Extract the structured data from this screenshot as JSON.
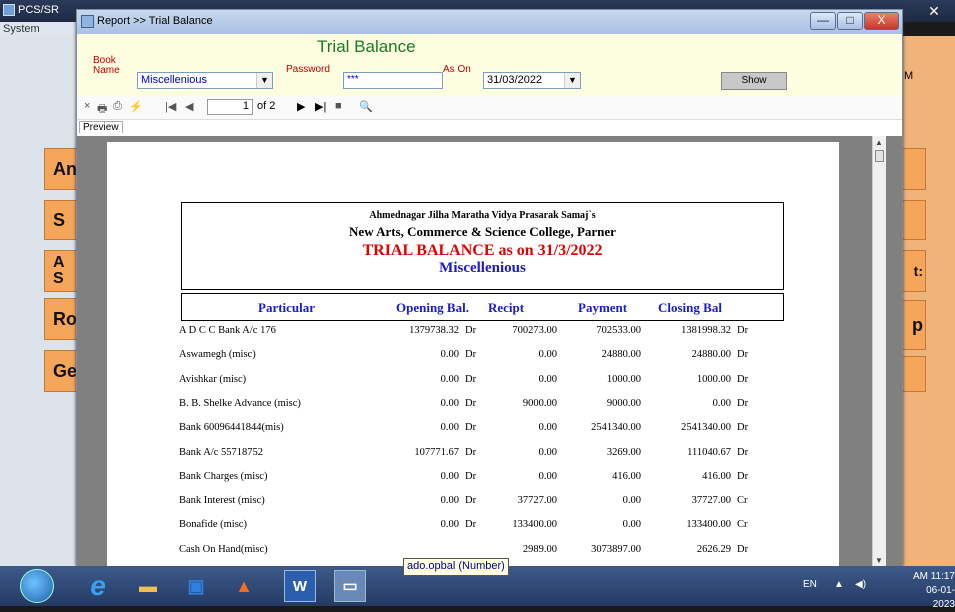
{
  "outer_window": {
    "title": "PCS/SR",
    "menu": "System",
    "close": "✕"
  },
  "side_buttons": [
    {
      "label": "An"
    },
    {
      "label": "S"
    },
    {
      "label": "A\nS"
    },
    {
      "label": "Ro"
    },
    {
      "label": "Ge"
    }
  ],
  "right_buttons": [
    {
      "label": "p"
    }
  ],
  "right_strip_letters": {
    "m": "M",
    "t": "t:"
  },
  "window": {
    "title": "Report >> Trial Balance",
    "controls": {
      "minimize": "—",
      "maximize": "□",
      "close": "X"
    }
  },
  "form": {
    "heading": "Trial Balance",
    "book_label": "Book\nName",
    "book_value": "Miscellenious",
    "password_label": "Password",
    "password_value": "***",
    "as_on_label": "As On",
    "as_on_value": "31/03/2022",
    "show_label": "Show"
  },
  "toolbar": {
    "close": "×",
    "print": "🖶",
    "export": "⎙",
    "lightning": "⚡",
    "first": "|◀",
    "prev": "◀",
    "page_value": "1",
    "page_of": "of 2",
    "next": "▶",
    "last": "▶|",
    "stop": "■",
    "search": "🔍"
  },
  "tab": "Preview",
  "report": {
    "line1": "Ahmednagar Jilha Maratha Vidya Prasarak Samaj`s",
    "line2": "New Arts, Commerce & Science College, Parner",
    "line3": "TRIAL BALANCE as on 31/3/2022",
    "line4": "Miscellenious",
    "columns": {
      "particular": "Particular",
      "opening": "Opening Bal.",
      "recipt": "Recipt",
      "payment": "Payment",
      "closing": "Closing Bal"
    },
    "rows": [
      {
        "name": "A D C C Bank A/c 176",
        "ob": "1379738.32",
        "obt": "Dr",
        "rc": "700273.00",
        "py": "702533.00",
        "cb": "1381998.32",
        "cbt": "Dr"
      },
      {
        "name": "Aswamegh (misc)",
        "ob": "0.00",
        "obt": "Dr",
        "rc": "0.00",
        "py": "24880.00",
        "cb": "24880.00",
        "cbt": "Dr"
      },
      {
        "name": "Avishkar (misc)",
        "ob": "0.00",
        "obt": "Dr",
        "rc": "0.00",
        "py": "1000.00",
        "cb": "1000.00",
        "cbt": "Dr"
      },
      {
        "name": "B. B. Shelke Advance (misc)",
        "ob": "0.00",
        "obt": "Dr",
        "rc": "9000.00",
        "py": "9000.00",
        "cb": "0.00",
        "cbt": "Dr"
      },
      {
        "name": "Bank 60096441844(mis)",
        "ob": "0.00",
        "obt": "Dr",
        "rc": "0.00",
        "py": "2541340.00",
        "cb": "2541340.00",
        "cbt": "Dr"
      },
      {
        "name": "Bank A/c 55718752",
        "ob": "107771.67",
        "obt": "Dr",
        "rc": "0.00",
        "py": "3269.00",
        "cb": "111040.67",
        "cbt": "Dr"
      },
      {
        "name": "Bank Charges (misc)",
        "ob": "0.00",
        "obt": "Dr",
        "rc": "0.00",
        "py": "416.00",
        "cb": "416.00",
        "cbt": "Dr"
      },
      {
        "name": "Bank Interest (misc)",
        "ob": "0.00",
        "obt": "Dr",
        "rc": "37727.00",
        "py": "0.00",
        "cb": "37727.00",
        "cbt": "Cr"
      },
      {
        "name": "Bonafide (misc)",
        "ob": "0.00",
        "obt": "Dr",
        "rc": "133400.00",
        "py": "0.00",
        "cb": "133400.00",
        "cbt": "Cr"
      },
      {
        "name": "Cash On Hand(misc)",
        "ob": "",
        "obt": "",
        "rc": "2989.00",
        "py": "3073897.00",
        "cb": "2626.29",
        "cbt": "Dr"
      }
    ]
  },
  "tooltip": "ado.opbal (Number)",
  "taskbar": {
    "lang": "EN",
    "time": "AM 11:17",
    "date": "06-01-2023",
    "apps": [
      "ie-icon",
      "folder-icon",
      "media-icon",
      "vlc-icon",
      "word-icon",
      "window-icon"
    ]
  }
}
